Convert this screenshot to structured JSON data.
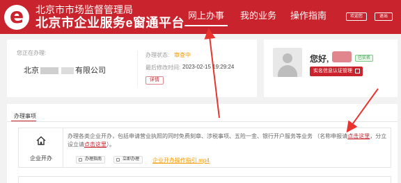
{
  "header": {
    "logo_letter": "e",
    "org_name": "北京市市场监督管理局",
    "platform_name": "北京市企业服务e窗通平台",
    "nav": {
      "online": "网上办事",
      "my_business": "我的业务",
      "guide": "操作指南"
    },
    "welcome_label": "欢迎您",
    "logout_label": "退出"
  },
  "company_panel": {
    "handling_label": "您正在办理:",
    "company_name_prefix": "北京",
    "company_name_suffix": "有限公司",
    "status_label": "办理状态:",
    "status_value": "审查中",
    "modified_label": "最后修改时间:",
    "modified_value": "2023-02-15 19:29:24",
    "detail_label": "详情"
  },
  "user_panel": {
    "greeting": "您好,",
    "auth_badge": "已实名",
    "auth_button": "实名信息认证管理"
  },
  "tasks": {
    "tab_label": "办理事项",
    "card": {
      "title": "企业开办",
      "desc_main": "办理各类企业开办，包括申请营业执照的同时免费刻章、涉税事项、五险一金、银行开户服务等业务 （名称申报请",
      "link1": "点击这里",
      "desc_mid": "，分立设立请",
      "link2": "点击这里",
      "desc_end": "）。",
      "guide_btn": "办理指南",
      "apply_btn": "立即办理",
      "doc_link": "企业开办操作指引.mp4"
    }
  },
  "colors": {
    "brand_red": "#c9232d",
    "status_orange": "#f39800"
  }
}
